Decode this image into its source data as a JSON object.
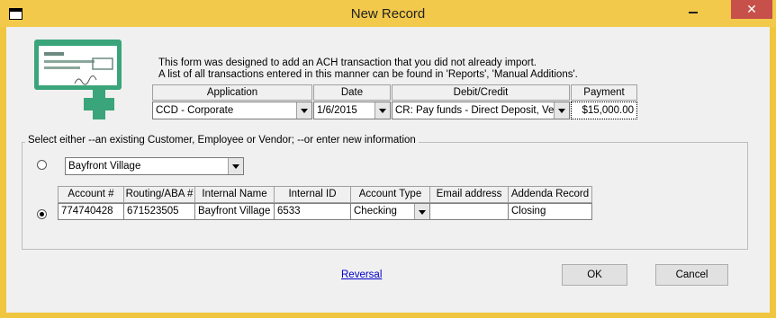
{
  "window": {
    "title": "New Record",
    "close_glyph": "✕",
    "icon": "app-window-icon",
    "min_icon": "minimize-icon"
  },
  "description": {
    "line1": "This form was designed to add an ACH transaction that you did not already import.",
    "line2": "A list of all transactions entered in this manner can be found in 'Reports', 'Manual Additions'."
  },
  "transaction": {
    "headers": {
      "application": "Application",
      "date": "Date",
      "debit_credit": "Debit/Credit",
      "payment": "Payment"
    },
    "application": "CCD - Corporate",
    "date": "1/6/2015",
    "debit_credit": "CR: Pay funds - Direct Deposit, Venc",
    "payment": "$15,000.00"
  },
  "selection": {
    "group_label": "Select either --an existing Customer, Employee or Vendor;  --or enter new information",
    "existing_value": "Bayfront Village",
    "existing_selected": false,
    "new_selected": true
  },
  "grid": {
    "headers": [
      "Account #",
      "Routing/ABA #",
      "Internal Name",
      "Internal ID",
      "Account Type",
      "Email address",
      "Addenda Record"
    ],
    "row": {
      "account": "774740428",
      "routing": "671523505",
      "internal_name": "Bayfront Village",
      "internal_id": "6533",
      "account_type": "Checking",
      "email": "",
      "addenda": "Closing"
    }
  },
  "footer": {
    "reversal_link": "Reversal",
    "ok_label": "OK",
    "cancel_label": "Cancel"
  },
  "colors": {
    "accent": "#f2c94a",
    "logo_green": "#3aa57a",
    "close_red": "#c7504b"
  }
}
